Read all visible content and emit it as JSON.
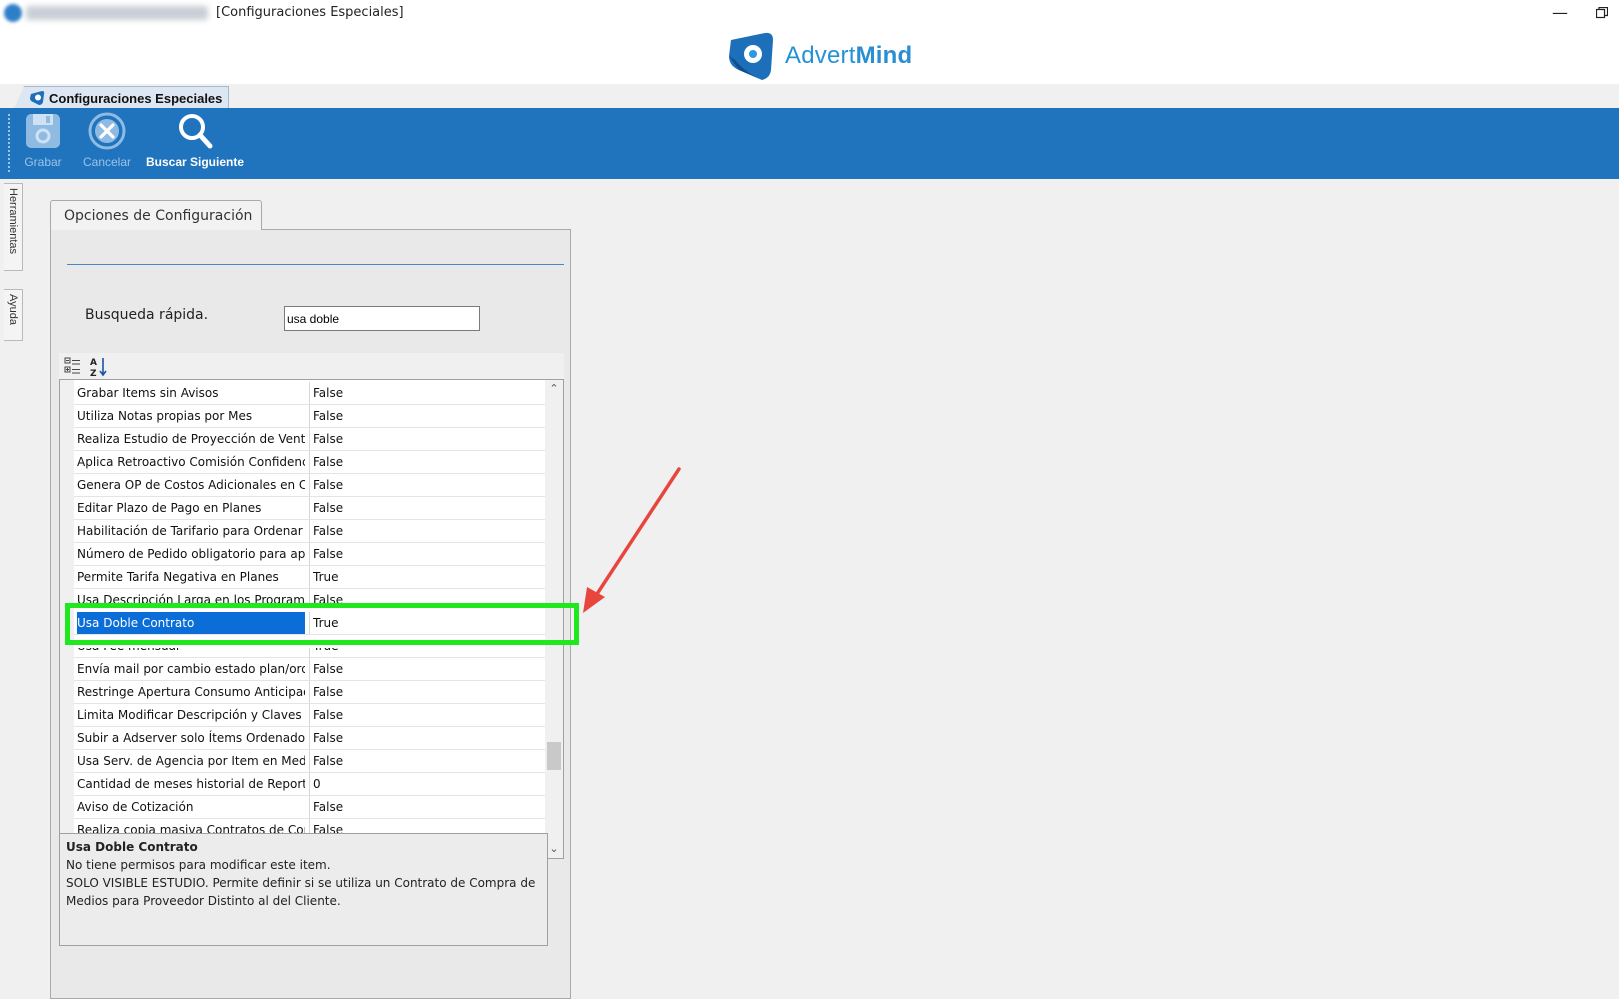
{
  "window": {
    "title": "[Configuraciones Especiales]",
    "minimize_glyph": "—"
  },
  "brand": {
    "name_light": "Advert",
    "name_bold": "Mind",
    "primary_color": "#1f74bd",
    "highlight_color": "#1fe81f",
    "arrow_color": "#e8463c"
  },
  "doc_tab": {
    "label": "Configuraciones Especiales"
  },
  "toolbar": {
    "save_label": "Grabar",
    "cancel_label": "Cancelar",
    "find_next_label": "Buscar Siguiente"
  },
  "side_tabs": {
    "tools": "Herramientas",
    "help": "Ayuda"
  },
  "panel": {
    "tab_label": "Opciones de Configuración",
    "quick_search_label": "Busqueda rápida.",
    "quick_search_value": "usa doble"
  },
  "grid": {
    "rows": [
      {
        "name": "Grabar Items sin Avisos",
        "value": "False"
      },
      {
        "name": "Utiliza Notas propias por Mes",
        "value": "False"
      },
      {
        "name": "Realiza Estudio de Proyección de Ventas",
        "value": "False"
      },
      {
        "name": "Aplica Retroactivo Comisión Confidencial",
        "value": "False"
      },
      {
        "name": "Genera OP de Costos Adicionales en Cer",
        "value": "False"
      },
      {
        "name": "Editar Plazo de Pago en Planes",
        "value": "False"
      },
      {
        "name": "Habilitación de Tarifario para Ordenar",
        "value": "False"
      },
      {
        "name": "Número de Pedido obligatorio para apro",
        "value": "False"
      },
      {
        "name": "Permite Tarifa Negativa en Planes",
        "value": "True"
      },
      {
        "name": "Usa Descripción Larga en los Programas",
        "value": "False"
      },
      {
        "name": "Usa Doble Contrato",
        "value": "True"
      },
      {
        "name": "Usa Fee mensual",
        "value": "True"
      },
      {
        "name": "Envía mail por cambio estado plan/orde",
        "value": "False"
      },
      {
        "name": "Restringe Apertura Consumo Anticipado",
        "value": "False"
      },
      {
        "name": "Limita Modificar Descripción y Claves d",
        "value": "False"
      },
      {
        "name": "Subir a Adserver solo Ítems Ordenados",
        "value": "False"
      },
      {
        "name": "Usa Serv. de Agencia por Item en Medios",
        "value": "False"
      },
      {
        "name": "Cantidad de meses historial de Reportes",
        "value": "0"
      },
      {
        "name": "Aviso de Cotización",
        "value": "False"
      },
      {
        "name": "Realiza copia masiva Contratos de Comp",
        "value": "False"
      }
    ]
  },
  "description": {
    "title": "Usa Doble Contrato",
    "line1": "No tiene permisos para modificar este item.",
    "line2": "SOLO VISIBLE ESTUDIO. Permite definir si se utiliza un Contrato de Compra de",
    "line3": "Medios para Proveedor Distinto al del Cliente."
  }
}
